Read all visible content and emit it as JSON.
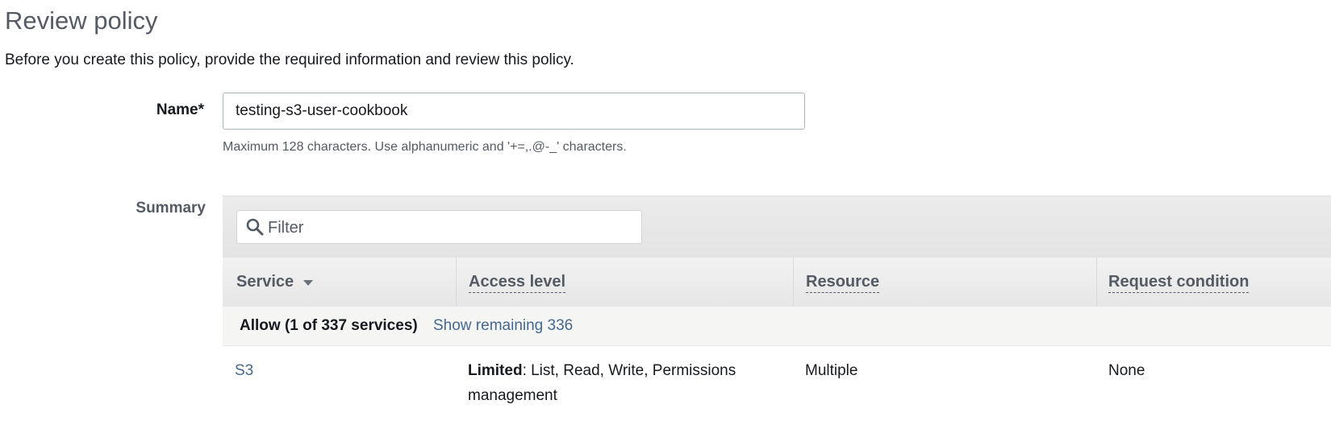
{
  "page": {
    "title": "Review policy",
    "subtitle": "Before you create this policy, provide the required information and review this policy."
  },
  "name_field": {
    "label": "Name*",
    "value": "testing-s3-user-cookbook",
    "hint": "Maximum 128 characters. Use alphanumeric and '+=,.@-_' characters."
  },
  "summary": {
    "label": "Summary",
    "filter": {
      "placeholder": "Filter",
      "icon": "search-icon"
    },
    "columns": {
      "service": "Service",
      "access_level": "Access level",
      "resource": "Resource",
      "request_condition": "Request condition"
    },
    "allow_row": {
      "label": "Allow (1 of 337 services)",
      "link": "Show remaining 336"
    },
    "rows": [
      {
        "service": "S3",
        "access_level_bold": "Limited",
        "access_level_rest": ": List, Read, Write, Permissions management",
        "resource": "Multiple",
        "request_condition": "None"
      }
    ]
  },
  "colors": {
    "link": "#44698f",
    "header_bg": "#e6e6e6",
    "text": "#16191f"
  }
}
